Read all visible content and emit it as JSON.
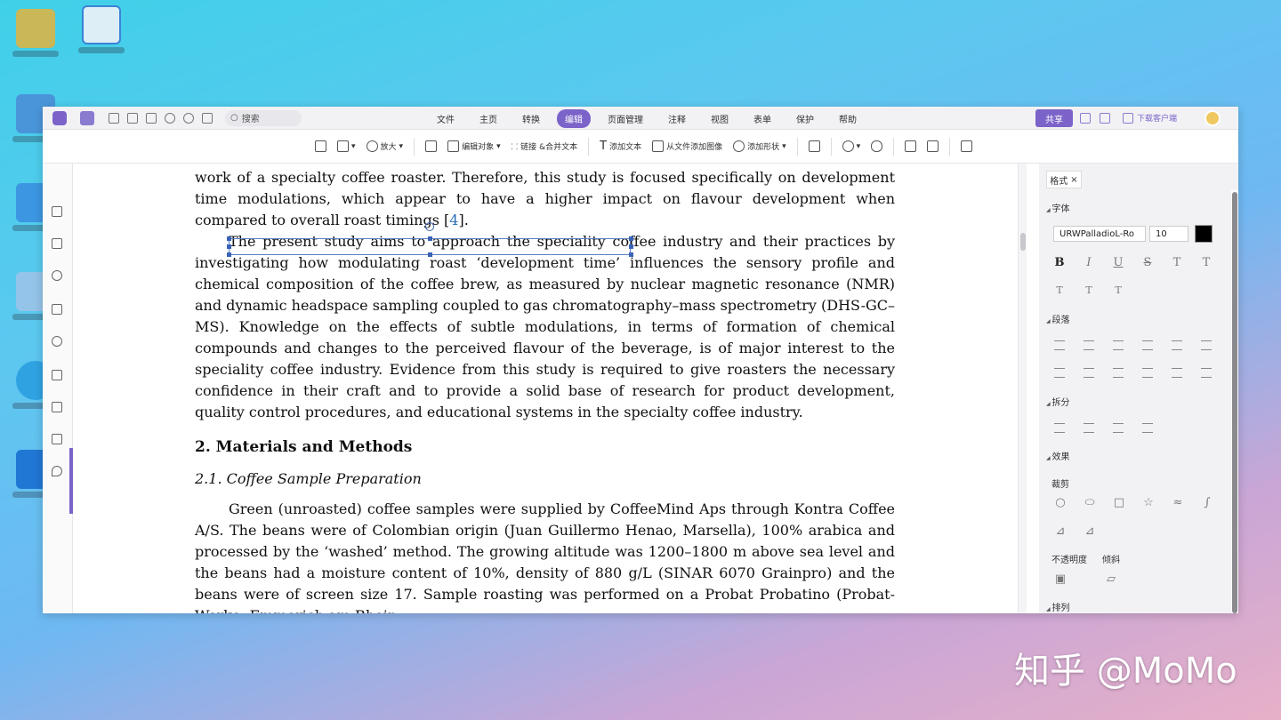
{
  "menubar": {
    "search_placeholder": "搜索",
    "items": [
      {
        "label": "文件"
      },
      {
        "label": "主页"
      },
      {
        "label": "转换"
      },
      {
        "label": "编辑"
      },
      {
        "label": "页面管理"
      },
      {
        "label": "注释"
      },
      {
        "label": "视图"
      },
      {
        "label": "表单"
      },
      {
        "label": "保护"
      },
      {
        "label": "帮助"
      }
    ],
    "share_label": "共享",
    "download_label": "下载客户端"
  },
  "toolbar": {
    "zoom_label": "放大",
    "edit_object_label": "编辑对象",
    "link_label": "链接",
    "merge_text_label": "&合并文本",
    "add_text_label": "添加文本",
    "add_image_label": "从文件添加图像",
    "add_shape_label": "添加形状"
  },
  "document": {
    "para1": "work of a specialty coffee roaster. Therefore, this study is focused specifically on development time modulations, which appear to have a higher impact on flavour development when compared to overall roast timings [",
    "para1_ref": "4",
    "para1_end": "].",
    "para2": "The present study aims to approach the speciality coffee industry and their practices by investigating how modulating roast ‘development time’ influences the sensory profile and chemical composition of the coffee brew, as measured by nuclear magnetic resonance (NMR) and dynamic headspace sampling coupled to gas chromatography–mass spectrometry (DHS-GC–MS). Knowledge on the effects of subtle modulations, in terms of formation of chemical compounds and changes to the perceived flavour of the beverage, is of major interest to the speciality coffee industry. Evidence from this study is required to give roasters the necessary confidence in their craft and to provide a solid base of research for product development, quality control procedures, and educational systems in the specialty coffee industry.",
    "heading2": "2. Materials and Methods",
    "heading3": "2.1. Coffee Sample Preparation",
    "para3": "Green (unroasted) coffee samples were supplied by CoffeeMind Aps through Kontra Coffee A/S. The beans were of Colombian origin (Juan Guillermo Henao, Marsella), 100% arabica and processed by the ‘washed’ method. The growing altitude was 1200–1800 m above sea level and the beans had a moisture content of 10%, density of 880 g/L (SINAR 6070 Grainpro) and the beans were of screen size 17. Sample roasting was performed on a Probat Probatino (Probat-Werke, Emmerich am Rhein,"
  },
  "panel": {
    "tab_label": "格式",
    "font_section": "字体",
    "font_name": "URWPalladioL-Ro",
    "font_size": "10",
    "font_color": "#000000",
    "paragraph_section": "段落",
    "split_section": "拆分",
    "effects_section": "效果",
    "crop_label": "裁剪",
    "opacity_label": "不透明度",
    "skew_label": "倾斜",
    "arrange_section": "排列"
  },
  "watermark": "知乎 @MoMo"
}
